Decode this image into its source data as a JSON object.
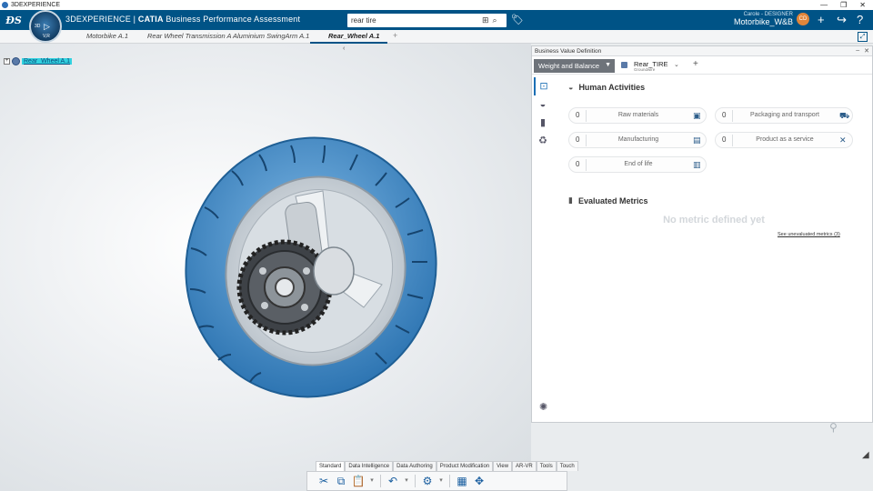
{
  "window": {
    "title": "3DEXPERIENCE",
    "controls": [
      "—",
      "❐",
      "✕"
    ]
  },
  "topbar": {
    "brand_prefix": "3DEXPERIENCE | ",
    "brand_bold": "CATIA",
    "brand_app": " Business Performance Assessment",
    "search_value": "rear tire",
    "user": "Carole - DESIGNER",
    "space": "Motorbike_W&B",
    "compass_3d": "3D",
    "compass_v": "V,R",
    "avatar_initials": "CD"
  },
  "tabs": [
    {
      "label": "Motorbike A.1",
      "active": false
    },
    {
      "label": "Rear Wheel Transmission A",
      "active": false
    },
    {
      "label": "Aluminium SwingArm A.1",
      "active": false
    },
    {
      "label": "Rear_Wheel A.1",
      "active": true
    }
  ],
  "tree": {
    "root_label": "Rear_Wheel A.1"
  },
  "action_bar": {
    "tabs": [
      "Standard",
      "Data Intelligence",
      "Data Authoring",
      "Product Modification",
      "View",
      "AR-VR",
      "Tools",
      "Touch"
    ],
    "active_tab": "Standard"
  },
  "panel": {
    "title": "Business Value Definition",
    "dropdown_label": "Weight and Balance",
    "object_name": "Rear_TIRE",
    "object_sub": "Groundwire",
    "human_activities_title": "Human Activities",
    "activities": [
      {
        "value": "0",
        "label": "Raw materials",
        "icon": "box-icon"
      },
      {
        "value": "0",
        "label": "Packaging and transport",
        "icon": "truck-icon"
      },
      {
        "value": "0",
        "label": "Manufacturing",
        "icon": "factory-icon"
      },
      {
        "value": "0",
        "label": "Product as a service",
        "icon": "tools-icon"
      },
      {
        "value": "0",
        "label": "End of life",
        "icon": "trash-icon"
      }
    ],
    "metrics_title": "Evaluated Metrics",
    "no_metric_text": "No metric defined yet",
    "see_link": "See unevaluated metrics (3)"
  },
  "colors": {
    "topbar": "#005386",
    "wheel_blue": "#4a90c8",
    "accent": "#1b6fb4"
  }
}
